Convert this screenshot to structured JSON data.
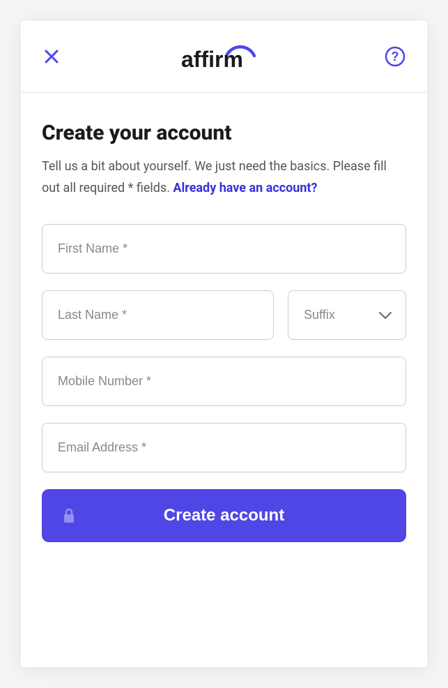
{
  "header": {
    "logo_text": "affirm"
  },
  "content": {
    "title": "Create your account",
    "subtitle_part1": "Tell us a bit about yourself. We just need the basics. Please fill out all required * fields. ",
    "login_link": "Already have an account?"
  },
  "form": {
    "first_name_placeholder": "First Name *",
    "last_name_placeholder": "Last Name *",
    "suffix_placeholder": "Suffix",
    "mobile_placeholder": "Mobile Number *",
    "email_placeholder": "Email Address *",
    "submit_label": "Create account"
  },
  "colors": {
    "primary": "#4f46e5",
    "link": "#3a2fd9"
  }
}
